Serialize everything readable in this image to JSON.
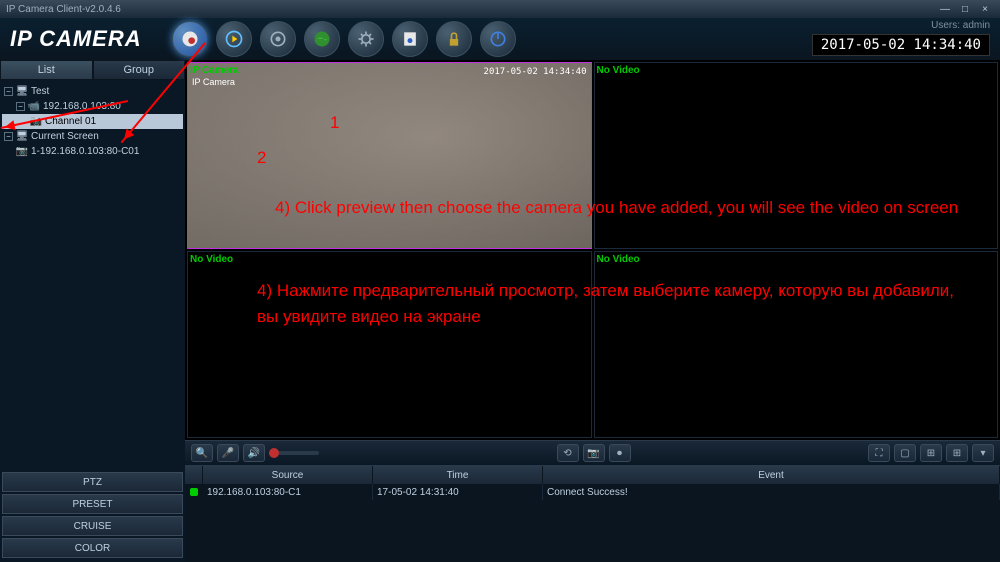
{
  "titlebar": {
    "title": "IP Camera Client-v2.0.4.6"
  },
  "header": {
    "logo": "IP CAMERA",
    "user_label": "Users: admin",
    "clock": "2017-05-02 14:34:40"
  },
  "sidebar": {
    "tabs": {
      "list": "List",
      "group": "Group"
    },
    "tree": {
      "test": "Test",
      "ip": "192.168.0.103:80",
      "channel": "Channel 01",
      "current_screen": "Current Screen",
      "screen_item": "1-192.168.0.103:80-C01"
    },
    "buttons": {
      "ptz": "PTZ",
      "preset": "PRESET",
      "cruise": "CRUISE",
      "color": "COLOR"
    }
  },
  "cells": {
    "c1": {
      "label": "IP Camera",
      "osd_name": "IP Camera",
      "osd_time": "2017-05-02 14:34:40"
    },
    "c2": {
      "label": "No Video"
    },
    "c3": {
      "label": "No Video"
    },
    "c4": {
      "label": "No Video"
    }
  },
  "log": {
    "headers": {
      "source": "Source",
      "time": "Time",
      "event": "Event"
    },
    "row": {
      "source": "192.168.0.103:80-C1",
      "time": "17-05-02 14:31:40",
      "event": "Connect Success!"
    }
  },
  "annotations": {
    "n1": "1",
    "n2": "2",
    "text_en": "4) Click preview then choose the camera you have added, you will see the video on screen",
    "text_ru": "4) Нажмите предварительный просмотр, затем выберите камеру, которую вы добавили, вы увидите видео на экране"
  }
}
